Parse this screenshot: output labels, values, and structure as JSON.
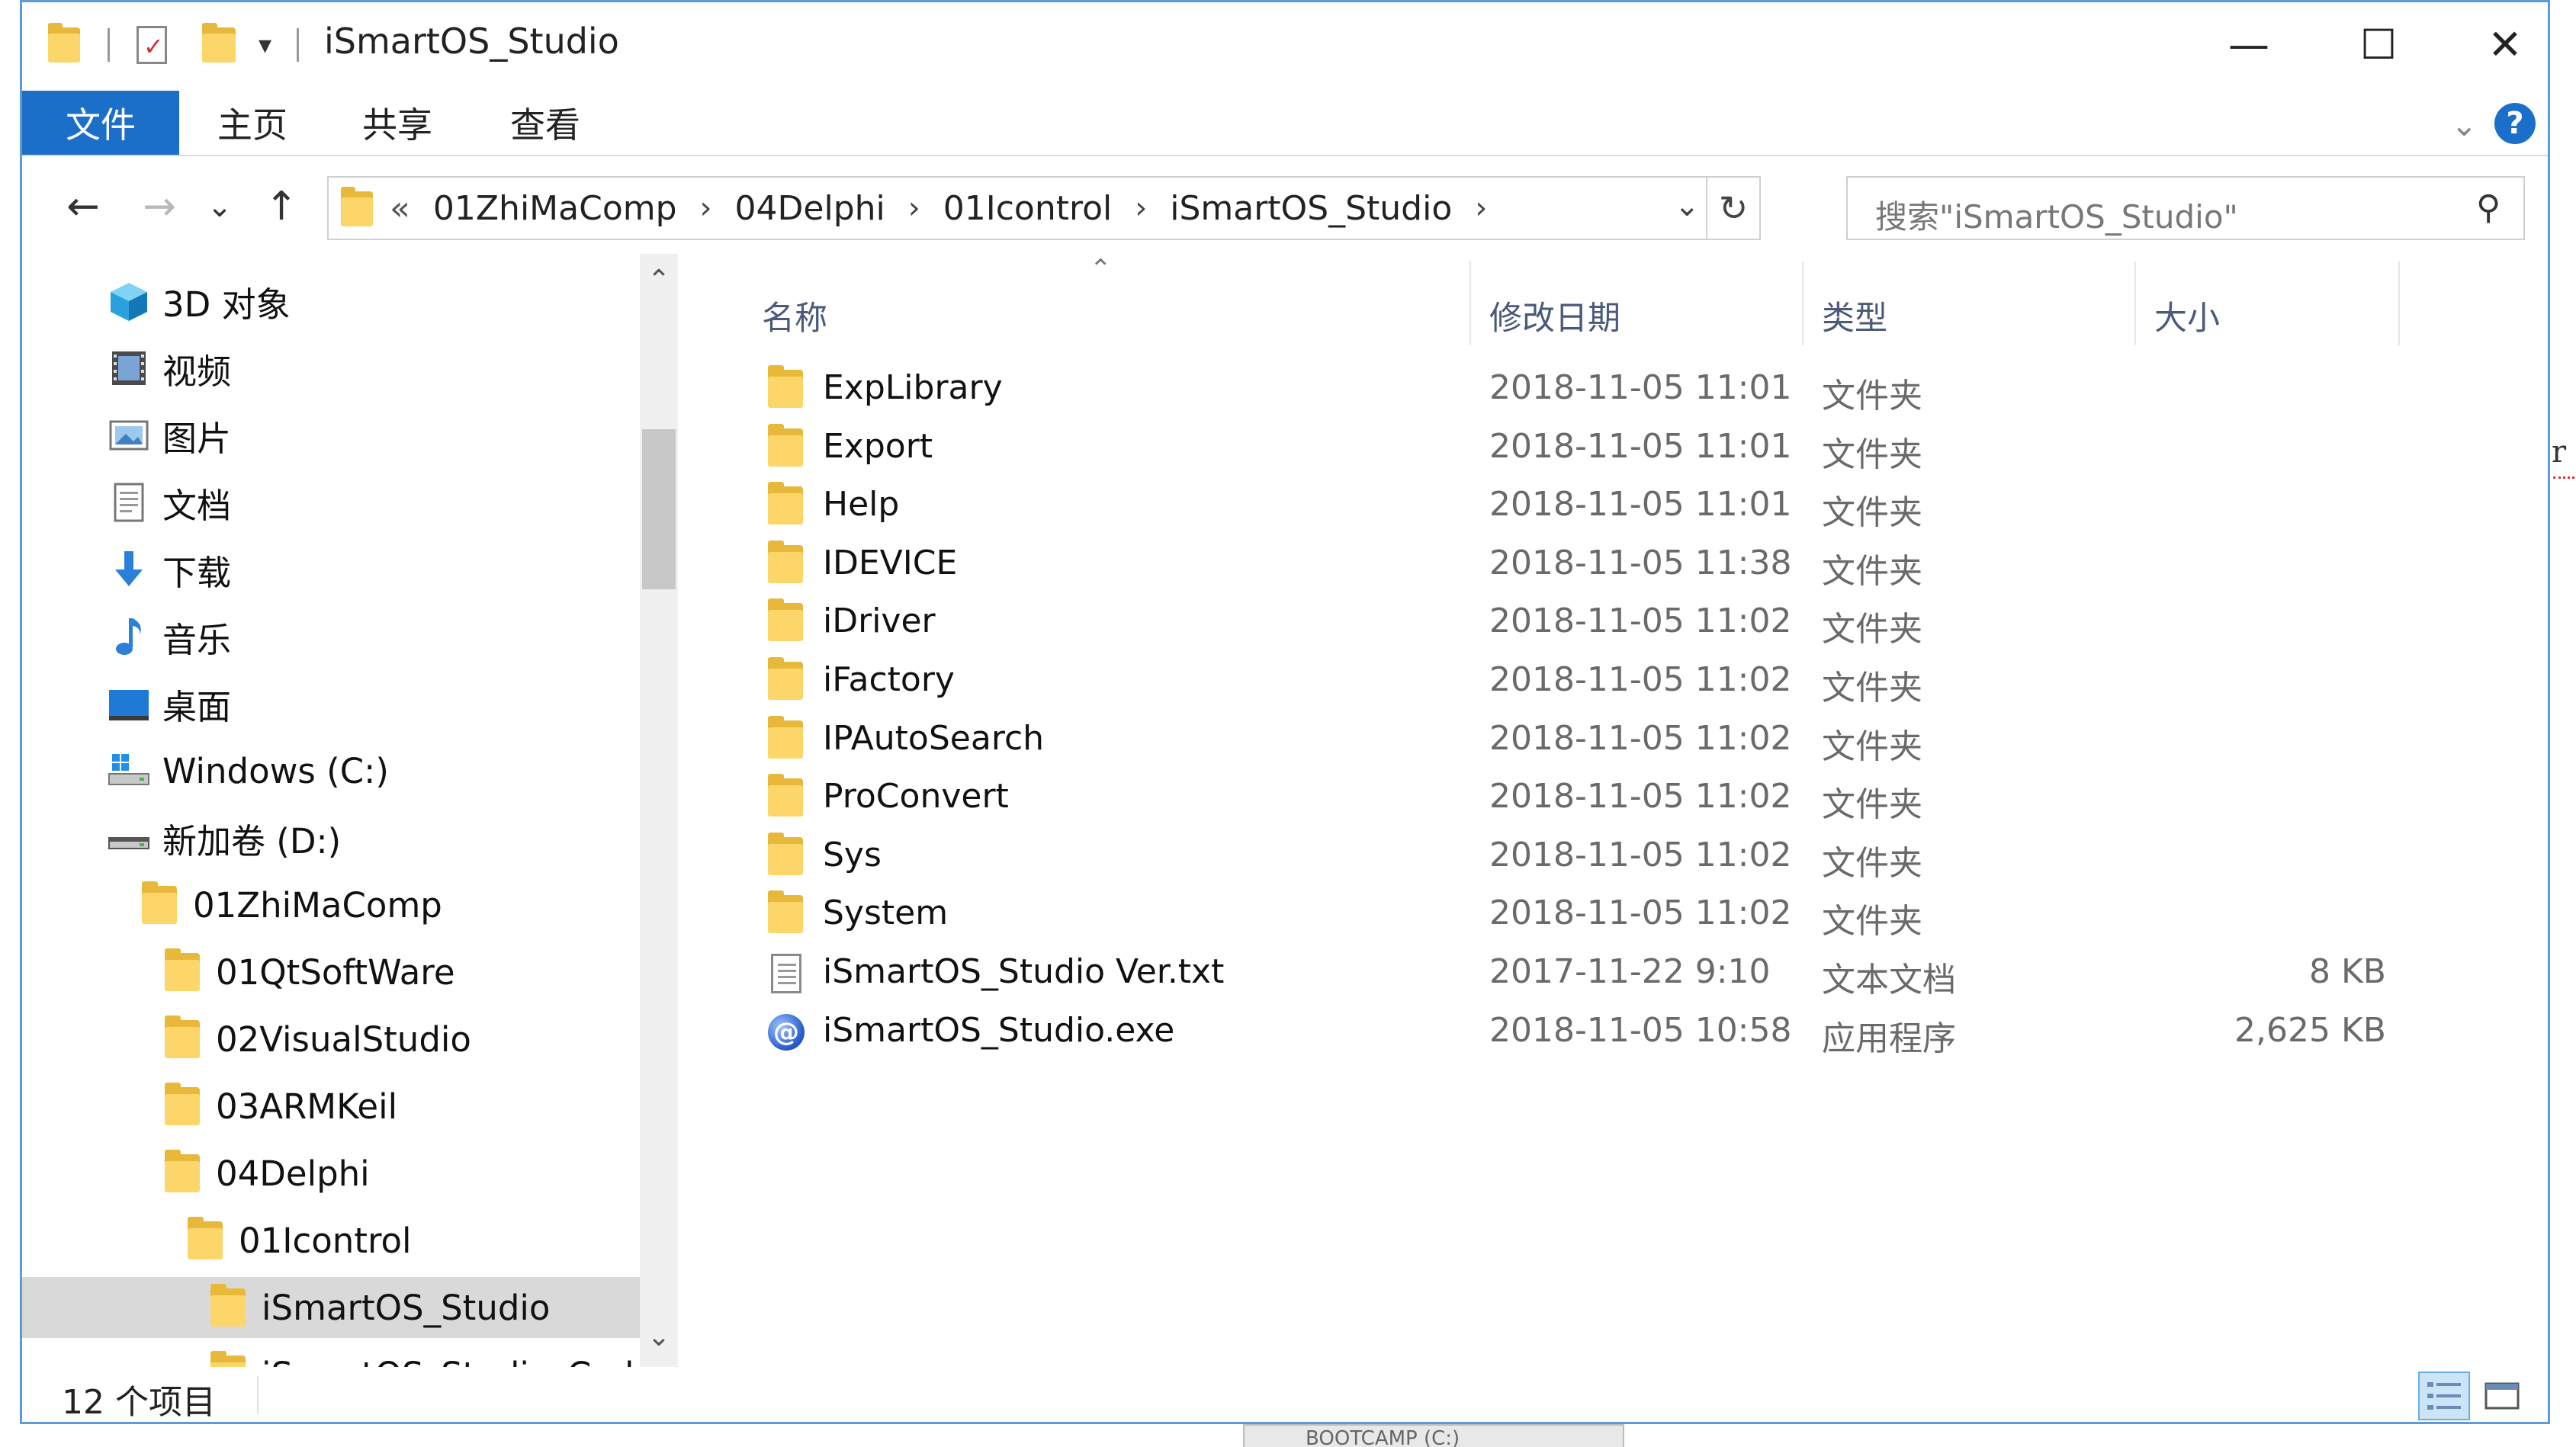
{
  "window": {
    "title": "iSmartOS_Studio",
    "controls": {
      "minimize": "—",
      "maximize": "☐",
      "close": "✕"
    }
  },
  "ribbon": {
    "tabs": [
      "文件",
      "主页",
      "共享",
      "查看"
    ],
    "help": "?",
    "accent": "#1c6fc9"
  },
  "nav": {
    "back": "←",
    "forward": "→",
    "recent": "⌄",
    "up": "↑",
    "address_prefix": "«",
    "breadcrumbs": [
      "01ZhiMaComp",
      "04Delphi",
      "01Icontrol",
      "iSmartOS_Studio"
    ],
    "search_placeholder": "搜索\"iSmartOS_Studio\""
  },
  "tree": {
    "items": [
      {
        "label": "3D 对象",
        "icon": "3d-objects-icon"
      },
      {
        "label": "视频",
        "icon": "videos-icon"
      },
      {
        "label": "图片",
        "icon": "pictures-icon"
      },
      {
        "label": "文档",
        "icon": "documents-icon"
      },
      {
        "label": "下载",
        "icon": "downloads-icon"
      },
      {
        "label": "音乐",
        "icon": "music-icon"
      },
      {
        "label": "桌面",
        "icon": "desktop-icon"
      },
      {
        "label": "Windows (C:)",
        "icon": "windows-drive-icon"
      },
      {
        "label": "新加卷 (D:)",
        "icon": "drive-icon"
      },
      {
        "label": "01ZhiMaComp",
        "icon": "folder-icon"
      },
      {
        "label": "01QtSoftWare",
        "icon": "folder-icon"
      },
      {
        "label": "02VisualStudio",
        "icon": "folder-icon"
      },
      {
        "label": "03ARMKeil",
        "icon": "folder-icon"
      },
      {
        "label": "04Delphi",
        "icon": "folder-icon"
      },
      {
        "label": "01Icontrol",
        "icon": "folder-icon"
      },
      {
        "label": "iSmartOS_Studio",
        "icon": "folder-icon"
      },
      {
        "label": "iSmartOS_Studio_Code",
        "icon": "folder-icon"
      }
    ],
    "selected_label": "iSmartOS_Studio"
  },
  "list": {
    "headers": {
      "name": "名称",
      "date": "修改日期",
      "type": "类型",
      "size": "大小"
    },
    "rows": [
      {
        "name": "ExpLibrary",
        "date": "2018-11-05 11:01",
        "type": "文件夹",
        "size": "",
        "icon": "folder-icon"
      },
      {
        "name": "Export",
        "date": "2018-11-05 11:01",
        "type": "文件夹",
        "size": "",
        "icon": "folder-icon"
      },
      {
        "name": "Help",
        "date": "2018-11-05 11:01",
        "type": "文件夹",
        "size": "",
        "icon": "folder-icon"
      },
      {
        "name": "IDEVICE",
        "date": "2018-11-05 11:38",
        "type": "文件夹",
        "size": "",
        "icon": "folder-icon"
      },
      {
        "name": "iDriver",
        "date": "2018-11-05 11:02",
        "type": "文件夹",
        "size": "",
        "icon": "folder-icon"
      },
      {
        "name": "iFactory",
        "date": "2018-11-05 11:02",
        "type": "文件夹",
        "size": "",
        "icon": "folder-icon"
      },
      {
        "name": "IPAutoSearch",
        "date": "2018-11-05 11:02",
        "type": "文件夹",
        "size": "",
        "icon": "folder-icon"
      },
      {
        "name": "ProConvert",
        "date": "2018-11-05 11:02",
        "type": "文件夹",
        "size": "",
        "icon": "folder-icon"
      },
      {
        "name": "Sys",
        "date": "2018-11-05 11:02",
        "type": "文件夹",
        "size": "",
        "icon": "folder-icon"
      },
      {
        "name": "System",
        "date": "2018-11-05 11:02",
        "type": "文件夹",
        "size": "",
        "icon": "folder-icon"
      },
      {
        "name": "iSmartOS_Studio Ver.txt",
        "date": "2017-11-22 9:10",
        "type": "文本文档",
        "size": "8 KB",
        "icon": "text-file-icon"
      },
      {
        "name": "iSmartOS_Studio.exe",
        "date": "2018-11-05 10:58",
        "type": "应用程序",
        "size": "2,625 KB",
        "icon": "application-icon"
      }
    ]
  },
  "status": {
    "count": "12 个项目"
  },
  "background": {
    "edge_text": "r",
    "taskbar_text": "BOOTCAMP (C:)"
  }
}
